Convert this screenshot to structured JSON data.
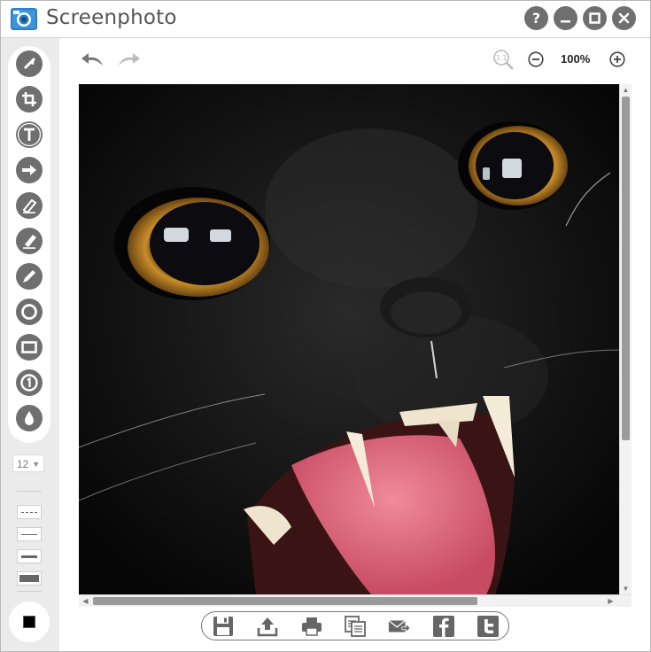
{
  "window": {
    "title": "Screenphoto",
    "buttons": {
      "help": "?",
      "minimize": "—",
      "maximize": "□",
      "close": "✕"
    }
  },
  "toolbar": {
    "tools": [
      {
        "name": "select",
        "icon": "cursor-arrow-icon"
      },
      {
        "name": "crop",
        "icon": "crop-icon"
      },
      {
        "name": "text",
        "icon": "text-icon"
      },
      {
        "name": "arrow",
        "icon": "arrow-right-icon"
      },
      {
        "name": "highlighter",
        "icon": "highlighter-icon"
      },
      {
        "name": "marker",
        "icon": "marker-icon"
      },
      {
        "name": "pencil",
        "icon": "pencil-icon"
      },
      {
        "name": "ellipse",
        "icon": "circle-icon"
      },
      {
        "name": "rectangle",
        "icon": "rectangle-icon"
      },
      {
        "name": "step-number",
        "icon": "number-one-icon"
      },
      {
        "name": "blur",
        "icon": "droplet-icon"
      }
    ],
    "font_size": "12",
    "line_styles": [
      "dashed",
      "thin",
      "medium",
      "thick"
    ],
    "current_color": "#000000"
  },
  "edit": {
    "zoom_level": "100%",
    "icons": [
      "undo-icon",
      "redo-icon",
      "zoom-actual-size-icon",
      "zoom-out-icon",
      "zoom-in-icon"
    ]
  },
  "canvas": {
    "image": "black cat face photo",
    "colors": {
      "background": "#0c0c0c",
      "eye": "#d6a23a",
      "tongue": "#e8667c",
      "teeth": "#f4ecd9"
    }
  },
  "actions": [
    {
      "name": "save",
      "icon": "save-icon"
    },
    {
      "name": "upload",
      "icon": "upload-icon"
    },
    {
      "name": "print",
      "icon": "print-icon"
    },
    {
      "name": "copy",
      "icon": "copy-icon"
    },
    {
      "name": "email",
      "icon": "email-icon"
    },
    {
      "name": "facebook",
      "icon": "facebook-icon"
    },
    {
      "name": "twitter",
      "icon": "twitter-icon"
    }
  ]
}
